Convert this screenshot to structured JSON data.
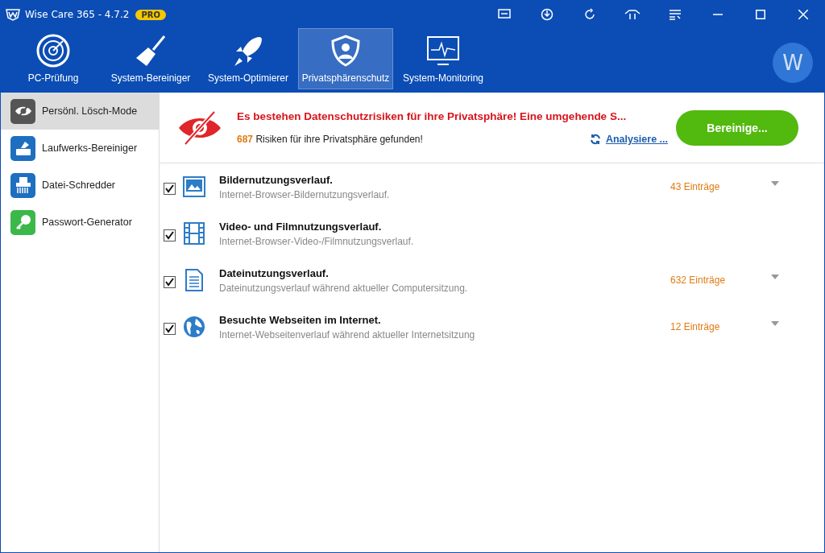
{
  "window": {
    "title": "Wise Care 365 - 4.7.2",
    "badge": "PRO"
  },
  "nav": [
    {
      "label": "PC-Prüfung",
      "kind": "radar",
      "selected": false
    },
    {
      "label": "System-Bereiniger",
      "kind": "broom",
      "selected": false
    },
    {
      "label": "System-Optimierer",
      "kind": "rocket",
      "selected": false
    },
    {
      "label": "Privatsphärenschutz",
      "kind": "shield",
      "selected": true
    },
    {
      "label": "System-Monitoring",
      "kind": "monitor",
      "selected": false
    }
  ],
  "avatar": "W",
  "sidebar": {
    "items": [
      {
        "label": "Persönl. Lösch-Mode",
        "kind": "eye",
        "color": "#555555",
        "selected": true
      },
      {
        "label": "Laufwerks-Bereiniger",
        "kind": "drive",
        "color": "#1e6fc0",
        "selected": false
      },
      {
        "label": "Datei-Schredder",
        "kind": "shredder",
        "color": "#1e6fc0",
        "selected": false
      },
      {
        "label": "Passwort-Generator",
        "kind": "key",
        "color": "#3cb84a",
        "selected": false
      }
    ]
  },
  "header": {
    "warning": "Es bestehen Datenschutzrisiken für ihre Privatsphäre! Eine umgehende S...",
    "count": "687",
    "count_text": "Risiken für ihre Privatsphäre gefunden!",
    "analyze_link": "Analysiere ...",
    "clean_button": "Bereinige..."
  },
  "items": [
    {
      "kind": "image",
      "title": "Bildernutzungsverlauf.",
      "description": "Internet-Browser-Bildernutzungsverlauf.",
      "entries": "43 Einträge",
      "checked": true
    },
    {
      "kind": "film",
      "title": "Video- und Filmnutzungsverlauf.",
      "description": "Internet-Browser-Video-/Filmnutzungsverlauf.",
      "checked": true
    },
    {
      "kind": "document",
      "title": "Dateinutzungsverlauf.",
      "description": "Dateinutzungsverlauf während aktueller Computersitzung.",
      "entries": "632 Einträge",
      "checked": true
    },
    {
      "kind": "globe",
      "title": "Besuchte Webseiten im Internet.",
      "description": "Internet-Webseitenverlauf während aktueller Internetsitzung",
      "entries": "12 Einträge",
      "checked": true
    }
  ]
}
